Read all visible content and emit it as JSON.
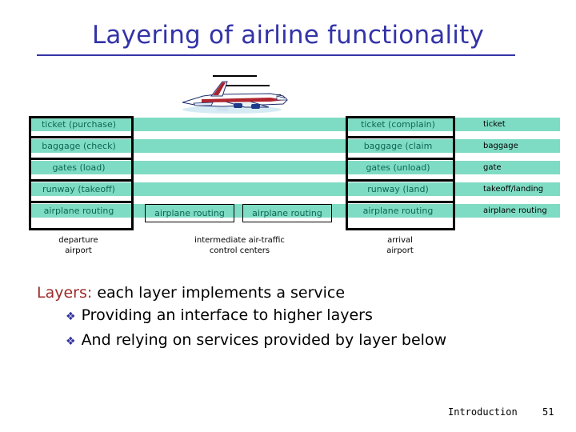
{
  "slide": {
    "title": "Layering of airline functionality",
    "footer_title": "Introduction",
    "page_number": "51"
  },
  "colors": {
    "title": "#3333a8",
    "bar": "#7fdcc4",
    "cell_text": "#0d6655",
    "keyword": "#9e2b2b",
    "bullet": "#33339c"
  },
  "diagram": {
    "layers": [
      {
        "left": "ticket (purchase)",
        "right": "ticket (complain)",
        "service": "ticket"
      },
      {
        "left": "baggage (check)",
        "right": "baggage (claim",
        "service": "baggage"
      },
      {
        "left": "gates (load)",
        "right": "gates (unload)",
        "service": "gate"
      },
      {
        "left": "runway (takeoff)",
        "right": "runway (land)",
        "service": "takeoff/landing"
      },
      {
        "left": "airplane routing",
        "right": "airplane routing",
        "service": "airplane routing"
      }
    ],
    "middle_boxes": [
      "airplane routing",
      "airplane routing"
    ],
    "captions": {
      "departure": "departure\nairport",
      "intermediate": "intermediate air-traffic\ncontrol centers",
      "arrival": "arrival\nairport"
    }
  },
  "body": {
    "keyword": "Layers:",
    "lead": " each layer implements a service",
    "bullets": [
      {
        "glyph": "❖",
        "text": "Providing an interface to higher layers"
      },
      {
        "glyph": "❖",
        "text": "And relying on services provided by layer below"
      }
    ]
  }
}
